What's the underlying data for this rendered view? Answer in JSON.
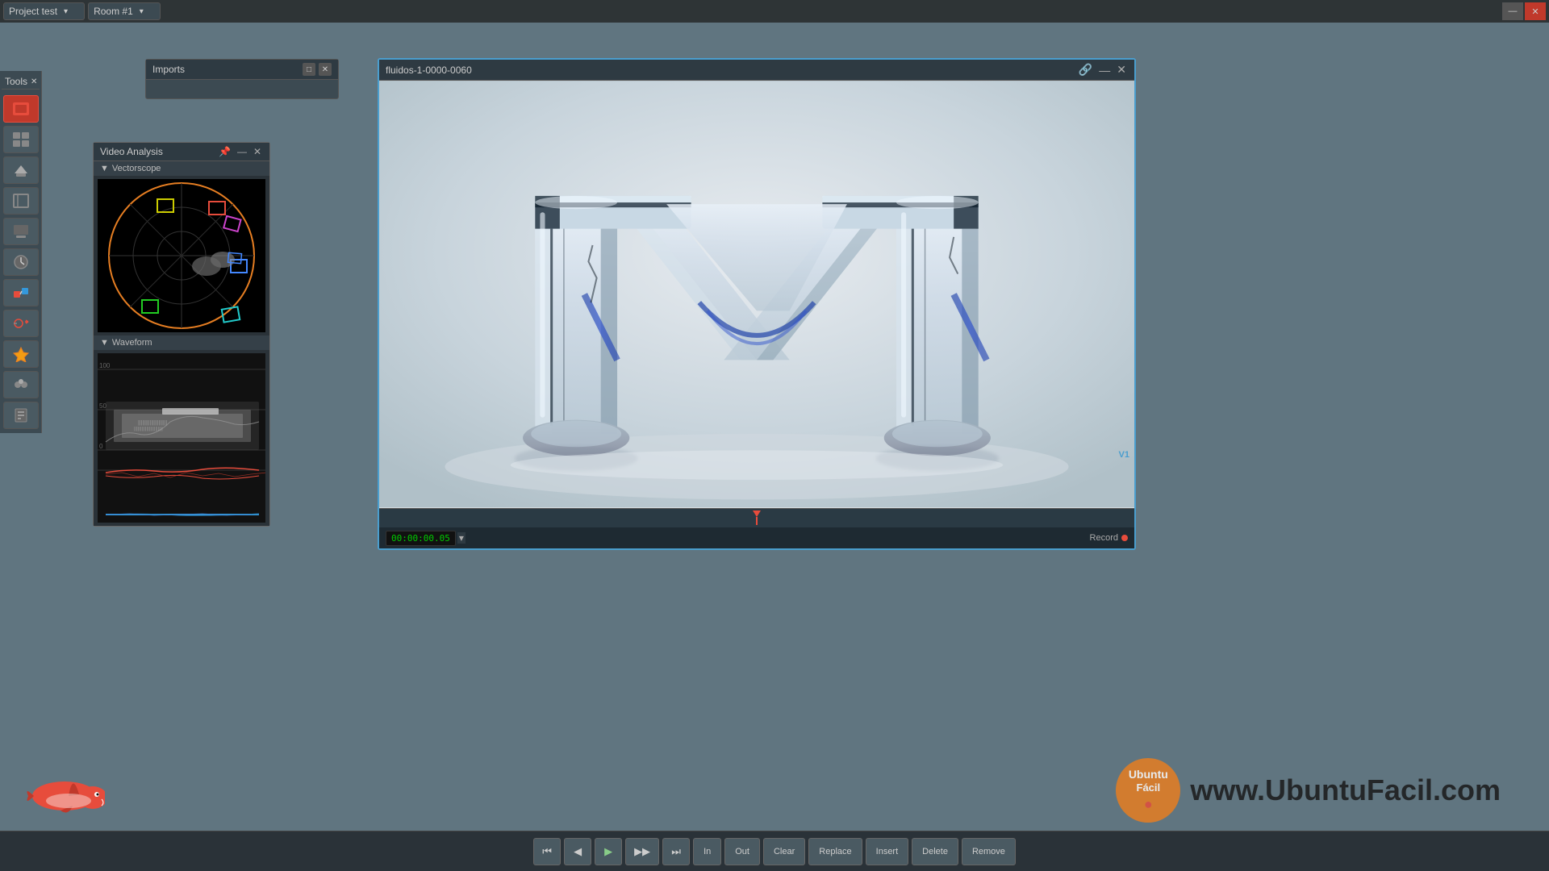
{
  "titlebar": {
    "project": "Project test",
    "room": "Room #1",
    "minimize_label": "—",
    "close_label": "✕"
  },
  "tools": {
    "label": "Tools",
    "close_label": "✕",
    "buttons": [
      "🔴",
      "⊞",
      "📁",
      "⊟",
      "🖨",
      "⚙",
      "⬡",
      "↺",
      "⊕",
      "👥",
      "🔌"
    ]
  },
  "imports_panel": {
    "title": "Imports",
    "minimize_label": "□",
    "close_label": "✕"
  },
  "video_analysis": {
    "title": "Video Analysis",
    "pin_label": "📌",
    "minimize_label": "—",
    "close_label": "✕",
    "vectorscope_label": "Vectorscope",
    "waveform_label": "Waveform"
  },
  "preview": {
    "title": "fluidos-1-0000-0060",
    "pin_label": "📌",
    "minimize_label": "—",
    "close_label": "✕",
    "timecode": "00:00:00.05",
    "record_label": "Record",
    "v1_label": "V1"
  },
  "transport": {
    "buttons": [
      {
        "id": "first",
        "label": "⏮",
        "text": false
      },
      {
        "id": "prev",
        "label": "◀",
        "text": false
      },
      {
        "id": "play",
        "label": "▶",
        "text": false
      },
      {
        "id": "next",
        "label": "▶▶",
        "text": false
      },
      {
        "id": "last",
        "label": "⏭",
        "text": false
      },
      {
        "id": "in",
        "label": "In",
        "text": true
      },
      {
        "id": "out",
        "label": "Out",
        "text": true
      },
      {
        "id": "clear",
        "label": "Clear",
        "text": true
      },
      {
        "id": "replace",
        "label": "Replace",
        "text": true
      },
      {
        "id": "insert",
        "label": "Insert",
        "text": true
      },
      {
        "id": "delete",
        "label": "Delete",
        "text": true
      },
      {
        "id": "remove",
        "label": "Remove",
        "text": true
      }
    ]
  },
  "brand": {
    "ubuntu_line1": "Ubuntu",
    "ubuntu_line2": "Fácil",
    "website": "www.UbuntuFacil.com"
  }
}
